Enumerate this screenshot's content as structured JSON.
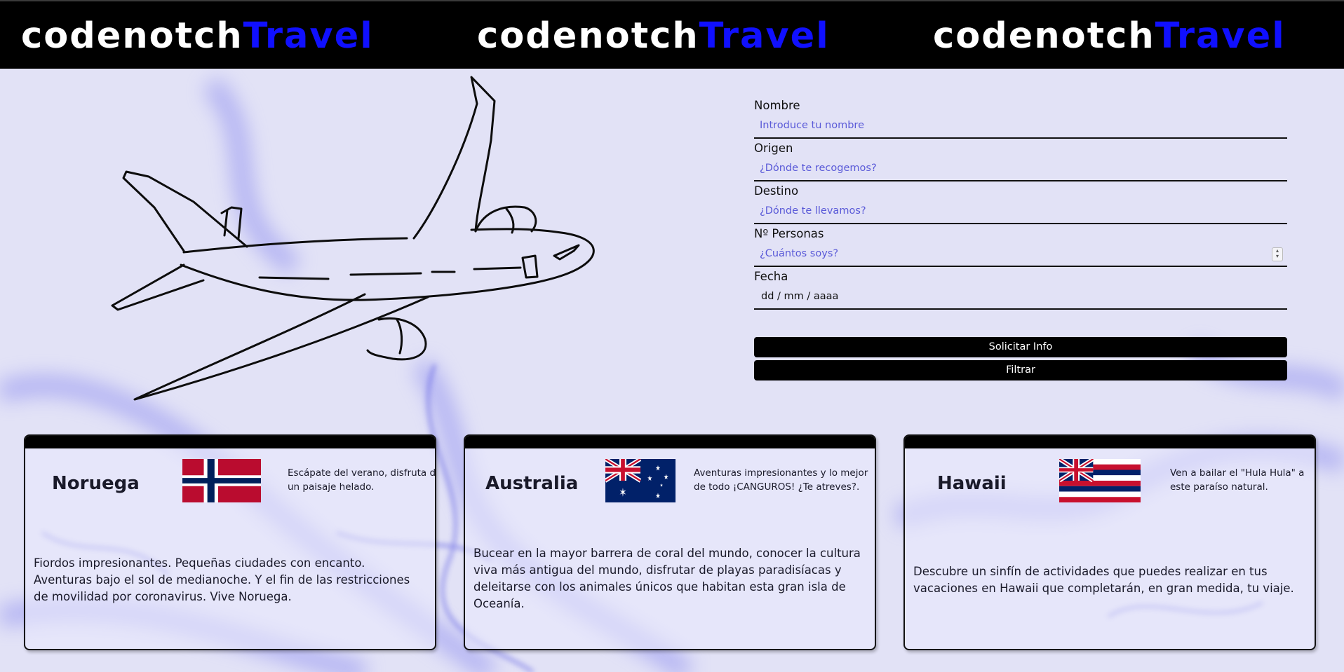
{
  "header": {
    "logos": [
      {
        "part1": "codenotch",
        "part2": "Travel"
      },
      {
        "part1": "codenotch",
        "part2": "Travel"
      },
      {
        "part1": "codenotch",
        "part2": "Travel"
      }
    ]
  },
  "form": {
    "fields": [
      {
        "label": "Nombre",
        "placeholder": "Introduce tu nombre",
        "value": ""
      },
      {
        "label": "Origen",
        "placeholder": "¿Dónde te recogemos?",
        "value": ""
      },
      {
        "label": "Destino",
        "placeholder": "¿Dónde te llevamos?",
        "value": ""
      },
      {
        "label": "Nº Personas",
        "placeholder": "¿Cuántos soys?",
        "value": ""
      },
      {
        "label": "Fecha",
        "placeholder": "",
        "value": "dd / mm / aaaa"
      }
    ],
    "buttons": {
      "request": "Solicitar Info",
      "filter": "Filtrar"
    }
  },
  "destinations": [
    {
      "name": "Noruega",
      "flag": "norway-flag",
      "tagline": "Escápate del verano, disfruta de un paisaje helado.",
      "description": "Fiordos impresionantes. Pequeñas ciudades con encanto. Aventuras bajo el sol de medianoche. Y el fin de las restricciones de movilidad por coronavirus. Vive Noruega."
    },
    {
      "name": "Australia",
      "flag": "australia-flag",
      "tagline": "Aventuras impresionantes y lo mejor de todo ¡CANGUROS! ¿Te atreves?.",
      "description": "Bucear en la mayor barrera de coral del mundo, conocer la cultura viva más antigua del mundo, disfrutar de playas paradisíacas y deleitarse con los animales únicos que habitan esta gran isla de Oceanía."
    },
    {
      "name": "Hawaii",
      "flag": "hawaii-flag",
      "tagline": "Ven a bailar el \"Hula Hula\" a este paraíso natural.",
      "description": "Descubre un sinfín de actividades que puedes realizar en tus vacaciones en Hawaii que completarán, en gran medida, tu viaje."
    }
  ],
  "colors": {
    "accent": "#1010ff",
    "header_bg": "#000000",
    "page_bg": "#dcdcf4",
    "placeholder": "#5a5ad8"
  },
  "icons": {
    "illustration": "airplane-sketch-icon",
    "spinner": "number-spinner-icon"
  }
}
